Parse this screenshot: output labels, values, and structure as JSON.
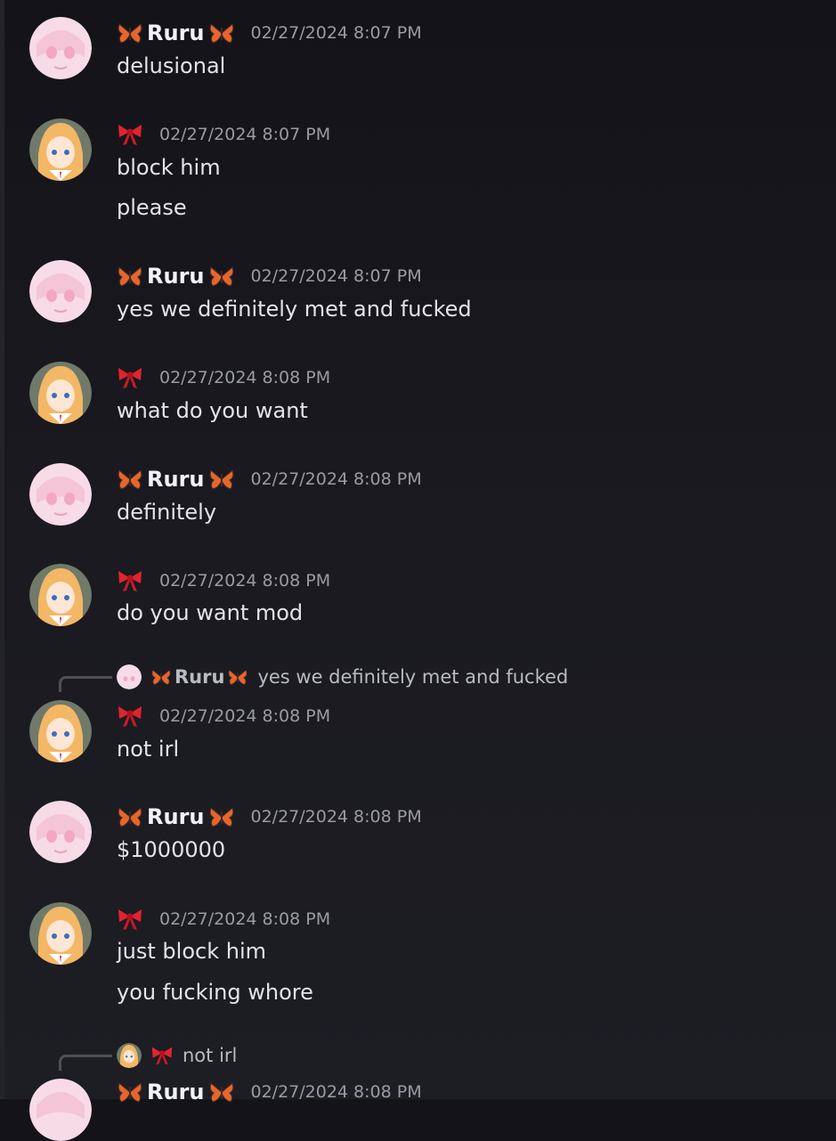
{
  "users": {
    "ruru": {
      "name": "Ruru",
      "emoji_icon": "butterfly-icon"
    },
    "bow": {
      "name": "",
      "emoji_icon": "ribbon-bow-icon"
    }
  },
  "messages": [
    {
      "author": "ruru",
      "time": "02/27/2024 8:07 PM",
      "lines": [
        "delusional"
      ]
    },
    {
      "author": "bow",
      "time": "02/27/2024 8:07 PM",
      "lines": [
        "block him",
        "please"
      ]
    },
    {
      "author": "ruru",
      "time": "02/27/2024 8:07 PM",
      "lines": [
        "yes we definitely met and fucked"
      ]
    },
    {
      "author": "bow",
      "time": "02/27/2024 8:08 PM",
      "lines": [
        "what do you want"
      ]
    },
    {
      "author": "ruru",
      "time": "02/27/2024 8:08 PM",
      "lines": [
        "definitely"
      ]
    },
    {
      "author": "bow",
      "time": "02/27/2024 8:08 PM",
      "lines": [
        "do you want mod"
      ]
    },
    {
      "author": "bow",
      "time": "02/27/2024 8:08 PM",
      "lines": [
        "not irl"
      ],
      "reply": {
        "author": "ruru",
        "name": "Ruru",
        "text": "yes we definitely met and fucked"
      }
    },
    {
      "author": "ruru",
      "time": "02/27/2024 8:08 PM",
      "lines": [
        "$1000000"
      ]
    },
    {
      "author": "bow",
      "time": "02/27/2024 8:08 PM",
      "lines": [
        "just block him",
        "you fucking whore"
      ]
    },
    {
      "author": "ruru",
      "time": "02/27/2024 8:08 PM",
      "lines": [],
      "reply": {
        "author": "bow",
        "name": "",
        "text": "not irl"
      }
    }
  ],
  "colors": {
    "background": "#1a1a20",
    "name": "#f2f3f5",
    "timestamp": "#9a9ca3",
    "message_text": "#e3e4e8",
    "butterfly": "#e8652a",
    "bow": "#e0242f"
  }
}
